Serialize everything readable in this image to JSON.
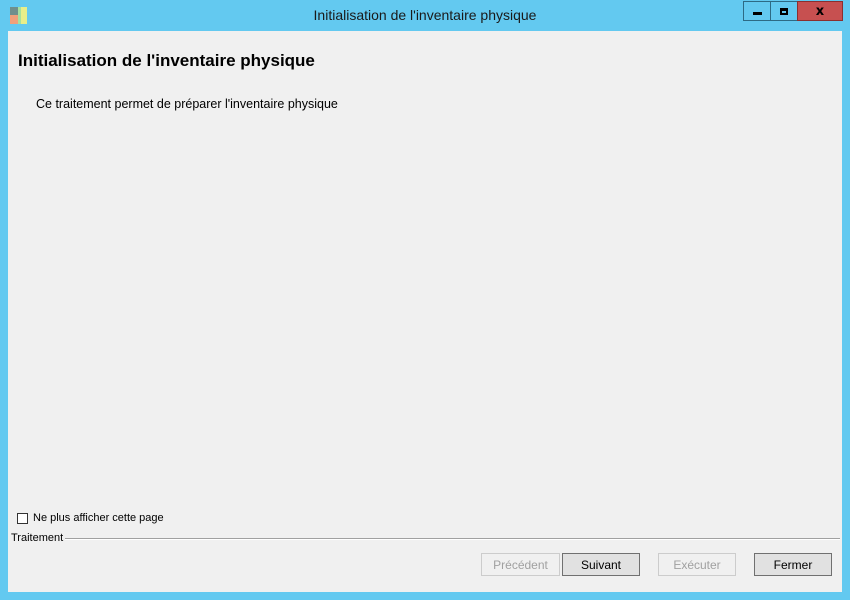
{
  "window": {
    "title": "Initialisation de l'inventaire physique",
    "accent_color": "#63c9f0",
    "close_color": "#c75050",
    "controls": {
      "minimize_icon": "minimize-icon",
      "maximize_icon": "maximize-icon",
      "close_glyph": "x"
    }
  },
  "main": {
    "heading": "Initialisation de l'inventaire physique",
    "description": "Ce traitement permet de préparer l'inventaire physique"
  },
  "options": {
    "dont_show_label": "Ne plus afficher cette page",
    "dont_show_checked": false
  },
  "footer": {
    "group_label": "Traitement",
    "buttons": {
      "previous": "Précédent",
      "next": "Suivant",
      "execute": "Exécuter",
      "close": "Fermer"
    }
  }
}
